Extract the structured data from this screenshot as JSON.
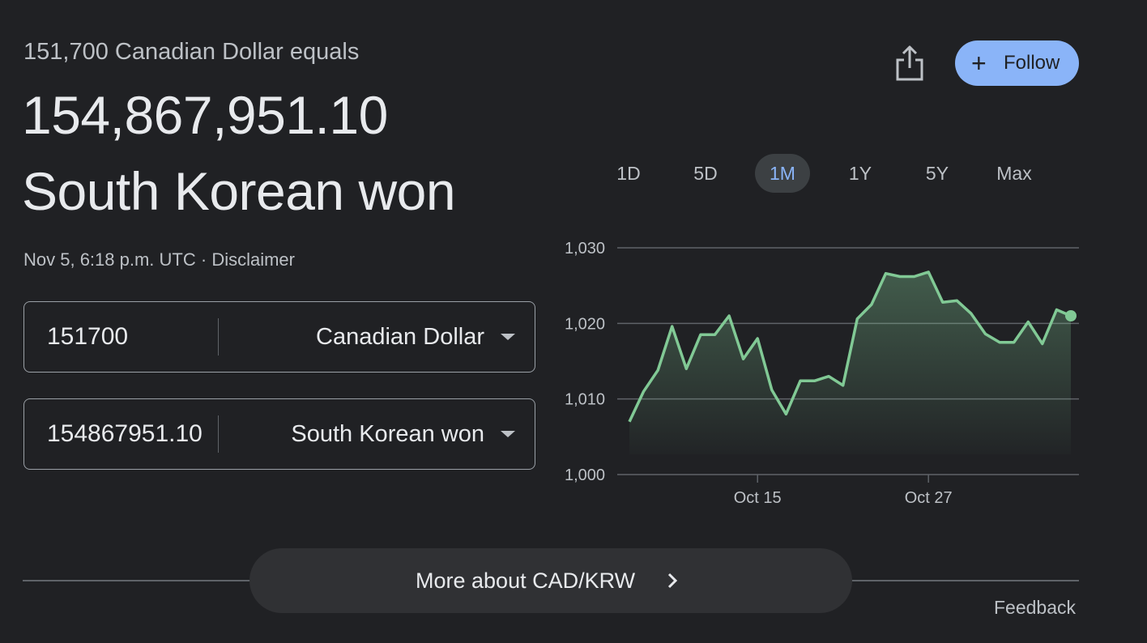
{
  "header": {
    "equals_text": "151,700 Canadian Dollar equals",
    "converted_amount": "154,867,951.10",
    "target_currency": "South Korean won",
    "timestamp": "Nov 5, 6:18 p.m. UTC",
    "separator": " · ",
    "disclaimer": "Disclaimer"
  },
  "actions": {
    "share_icon": "share-icon",
    "follow_label": "Follow",
    "follow_icon": "+"
  },
  "converter": {
    "from": {
      "value": "151700",
      "currency": "Canadian Dollar"
    },
    "to": {
      "value": "154867951.10",
      "currency": "South Korean won"
    }
  },
  "ranges": [
    "1D",
    "5D",
    "1M",
    "1Y",
    "5Y",
    "Max"
  ],
  "active_range": "1M",
  "more_label": "More about CAD/KRW",
  "feedback_label": "Feedback",
  "colors": {
    "background": "#202124",
    "line": "#81c995",
    "accent": "#8ab4f8",
    "grid": "#5f6368"
  },
  "chart_data": {
    "type": "area",
    "ylim": [
      1000,
      1030
    ],
    "yticks": [
      1000,
      1010,
      1020,
      1030
    ],
    "ytick_labels": [
      "1,000",
      "1,010",
      "1,020",
      "1,030"
    ],
    "xticks": [
      {
        "label": "Oct 15",
        "index": 9
      },
      {
        "label": "Oct 27",
        "index": 21
      }
    ],
    "grid": true,
    "values": [
      1007.0,
      1011.0,
      1013.8,
      1019.6,
      1014.0,
      1018.5,
      1018.5,
      1021.0,
      1015.3,
      1018.0,
      1011.2,
      1008.0,
      1012.4,
      1012.4,
      1013.0,
      1011.8,
      1020.6,
      1022.5,
      1026.6,
      1026.2,
      1026.2,
      1026.8,
      1022.8,
      1023.0,
      1021.3,
      1018.6,
      1017.5,
      1017.5,
      1020.2,
      1017.3,
      1021.8,
      1021.0
    ]
  }
}
